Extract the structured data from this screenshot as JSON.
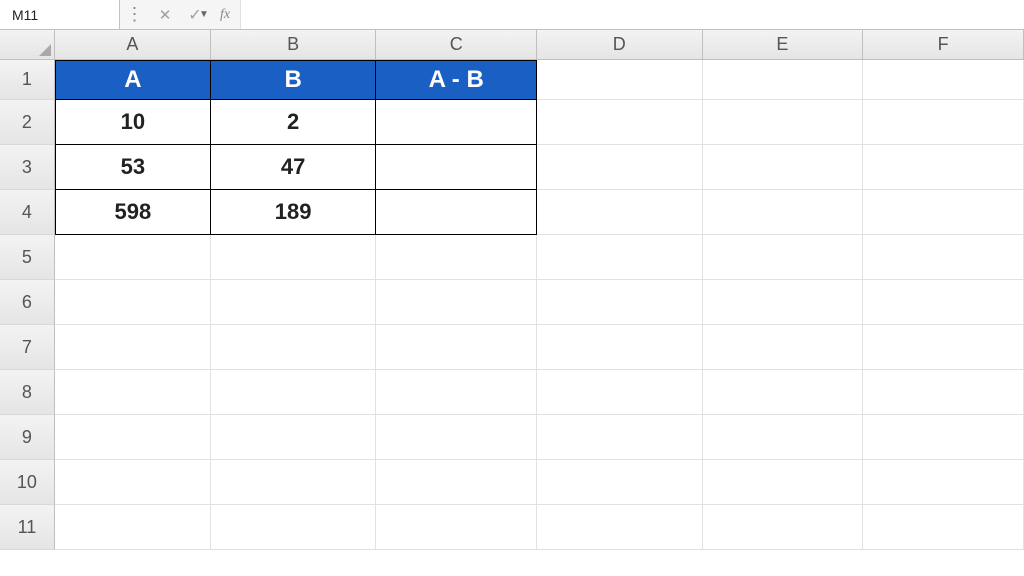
{
  "formula_bar": {
    "name_box": "M11",
    "formula_value": "",
    "fx_label": "fx"
  },
  "columns": [
    "A",
    "B",
    "C",
    "D",
    "E",
    "F"
  ],
  "row_numbers": [
    "1",
    "2",
    "3",
    "4",
    "5",
    "6",
    "7",
    "8",
    "9",
    "10",
    "11"
  ],
  "headers": {
    "a": "A",
    "b": "B",
    "c": "A - B"
  },
  "data_rows": [
    {
      "a": "10",
      "b": "2",
      "c": ""
    },
    {
      "a": "53",
      "b": "47",
      "c": ""
    },
    {
      "a": "598",
      "b": "189",
      "c": ""
    }
  ],
  "colors": {
    "header_bg": "#1a5fc4",
    "header_fg": "#ffffff"
  },
  "chart_data": {
    "type": "table",
    "columns": [
      "A",
      "B",
      "A - B"
    ],
    "rows": [
      [
        10,
        2,
        null
      ],
      [
        53,
        47,
        null
      ],
      [
        598,
        189,
        null
      ]
    ]
  }
}
